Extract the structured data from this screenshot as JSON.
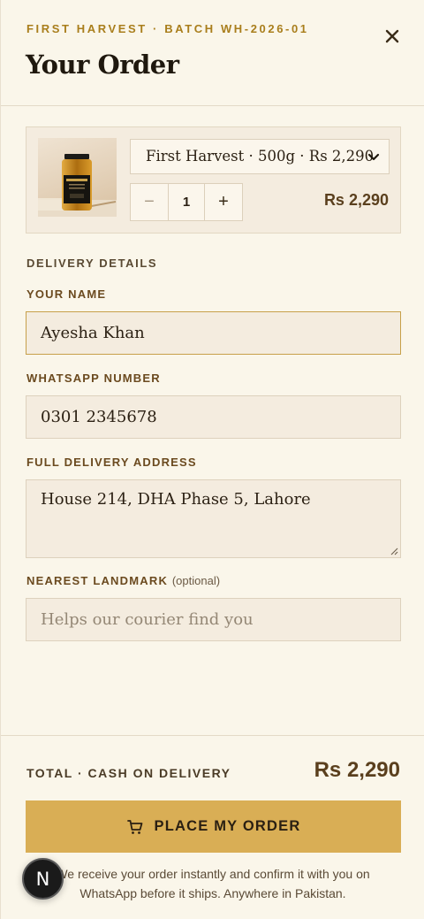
{
  "header": {
    "eyebrow": "FIRST HARVEST · BATCH WH-2026-01",
    "title": "Your Order",
    "close_icon": "close-icon"
  },
  "cart": {
    "variant_value": "First Harvest · 500g · Rs 2,290",
    "quantity": "1",
    "minus_label": "−",
    "plus_label": "+",
    "line_price": "Rs 2,290",
    "thumb_icon": "honey-jar-image"
  },
  "delivery": {
    "section_label": "DELIVERY DETAILS",
    "name_label": "YOUR NAME",
    "name_value": "Ayesha Khan",
    "whatsapp_label": "WHATSAPP NUMBER",
    "whatsapp_value": "0301 2345678",
    "address_label": "FULL DELIVERY ADDRESS",
    "address_value": "House 214, DHA Phase 5, Lahore",
    "landmark_label": "NEAREST LANDMARK",
    "landmark_optional": "(optional)",
    "landmark_placeholder": "Helps our courier find you"
  },
  "footer": {
    "total_label": "TOTAL · CASH ON DELIVERY",
    "total_value": "Rs 2,290",
    "cta_label": "PLACE MY ORDER",
    "cta_icon": "cart-icon",
    "note": "We receive your order instantly and confirm it with you on WhatsApp before it ships. Anywhere in Pakistan.",
    "badge_letter": "N"
  },
  "colors": {
    "accent": "#d9ae55",
    "eyebrow": "#a97e1c",
    "background": "#faf6ea"
  }
}
